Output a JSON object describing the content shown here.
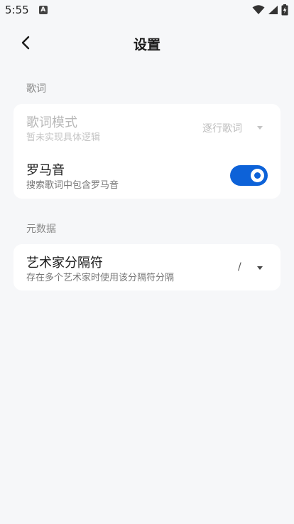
{
  "status_bar": {
    "time": "5:55",
    "notification_icon": "a-letter-icon",
    "icons": [
      "wifi-icon",
      "cell-signal-icon",
      "battery-charging-icon"
    ]
  },
  "header": {
    "title": "设置",
    "back_icon": "chevron-left-icon"
  },
  "sections": [
    {
      "title": "歌词",
      "items": [
        {
          "title": "歌词模式",
          "subtitle": "暂未实现具体逻辑",
          "control": "select",
          "value": "逐行歌词",
          "enabled": false
        },
        {
          "title": "罗马音",
          "subtitle": "搜索歌词中包含罗马音",
          "control": "toggle",
          "checked": true,
          "enabled": true
        }
      ]
    },
    {
      "title": "元数据",
      "items": [
        {
          "title": "艺术家分隔符",
          "subtitle": "存在多个艺术家时使用该分隔符分隔",
          "control": "select",
          "value": "/",
          "enabled": true
        }
      ]
    }
  ],
  "colors": {
    "background": "#f6f7f9",
    "card": "#ffffff",
    "accent": "#0d62d8",
    "section_title": "#888888"
  }
}
